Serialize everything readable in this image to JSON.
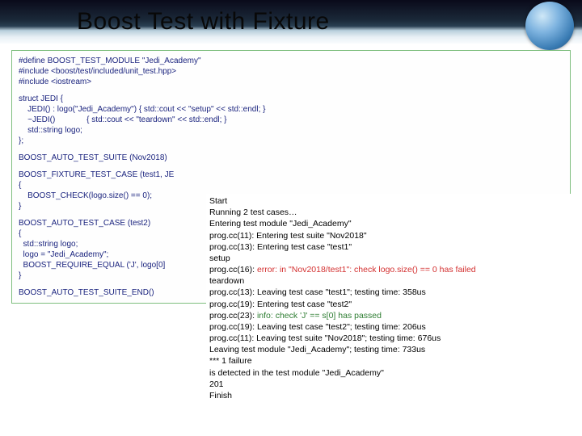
{
  "header": {
    "title": "Boost Test with Fixture"
  },
  "code": {
    "l1": "#define BOOST_TEST_MODULE \"Jedi_Academy\"",
    "l2": "#include <boost/test/included/unit_test.hpp>",
    "l3": "#include <iostream>",
    "s1": "struct JEDI {",
    "s2": "    JEDI() : logo(\"Jedi_Academy\") { std::cout << \"setup\" << std::endl; }",
    "s3": "    ~JEDI()              { std::cout << \"teardown\" << std::endl; }",
    "s4": "    std::string logo;",
    "s5": "};",
    "t1": "BOOST_AUTO_TEST_SUITE (Nov2018)",
    "t2": "BOOST_FIXTURE_TEST_CASE (test1, JE",
    "t3": "{",
    "t4": "    BOOST_CHECK(logo.size() == 0);",
    "t5": "}",
    "t6": "BOOST_AUTO_TEST_CASE (test2)",
    "t7": "{",
    "t8": "  std::string logo;",
    "t9": "  logo = \"Jedi_Academy\";",
    "t10": "  BOOST_REQUIRE_EQUAL ('J', logo[0]",
    "t11": "}",
    "t12": "BOOST_AUTO_TEST_SUITE_END()"
  },
  "output": {
    "o1": "Start",
    "o2": "Running 2 test cases…",
    "o3": "Entering test module \"Jedi_Academy\"",
    "o4": "prog.cc(11): Entering test suite \"Nov2018\"",
    "o5": "prog.cc(13): Entering test case \"test1\"",
    "o6": "setup",
    "o7a": "prog.cc(16): ",
    "o7b": "error: in \"Nov2018/test1\": check logo.size() == 0 has failed",
    "o8": "teardown",
    "o9": "prog.cc(13): Leaving test case \"test1\"; testing time: 358us",
    "o10": "prog.cc(19): Entering test case \"test2\"",
    "o11a": "prog.cc(23): ",
    "o11b": "info: check 'J' == s[0] has passed",
    "o12": "prog.cc(19): Leaving test case \"test2\"; testing time: 206us",
    "o13": "prog.cc(11): Leaving test suite \"Nov2018\"; testing time: 676us",
    "o14": "Leaving test module \"Jedi_Academy\"; testing time: 733us",
    "o15": "*** 1 failure",
    "o16": "is detected in the test module \"Jedi_Academy\"",
    "o17": "201",
    "o18": "Finish"
  }
}
